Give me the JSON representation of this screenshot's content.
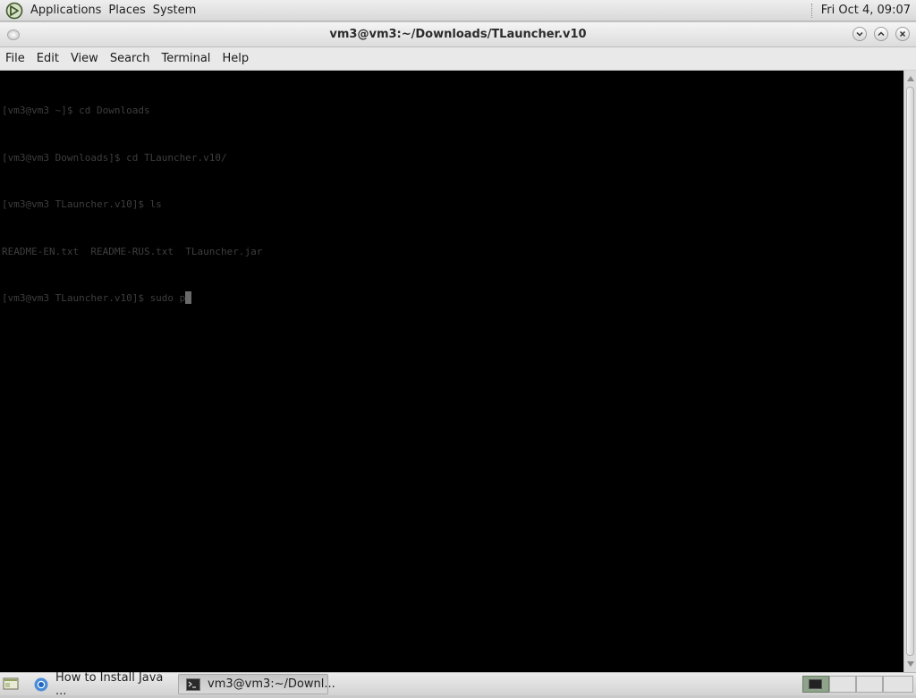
{
  "top_panel": {
    "menus": [
      "Applications",
      "Places",
      "System"
    ],
    "clock": "Fri Oct  4, 09:07",
    "logo_icon": "distro-logo-icon"
  },
  "window": {
    "title": "vm3@vm3:~/Downloads/TLauncher.v10",
    "controls": [
      "minimize-icon",
      "maximize-icon",
      "close-icon"
    ]
  },
  "menubar": {
    "items": [
      "File",
      "Edit",
      "View",
      "Search",
      "Terminal",
      "Help"
    ]
  },
  "terminal": {
    "background": "#000000",
    "lines": [
      "[vm3@vm3 ~]$ cd Downloads",
      "[vm3@vm3 Downloads]$ cd TLauncher.v10/",
      "[vm3@vm3 TLauncher.v10]$ ls",
      "README-EN.txt  README-RUS.txt  TLauncher.jar",
      "[vm3@vm3 TLauncher.v10]$ sudo p"
    ]
  },
  "taskbar": {
    "tasks": [
      {
        "label": "How to Install Java ...",
        "icon": "chrome-browser-icon",
        "active": false
      },
      {
        "label": "vm3@vm3:~/Downl...",
        "icon": "terminal-icon",
        "active": true
      }
    ],
    "workspaces": 4,
    "active_workspace": 1
  }
}
